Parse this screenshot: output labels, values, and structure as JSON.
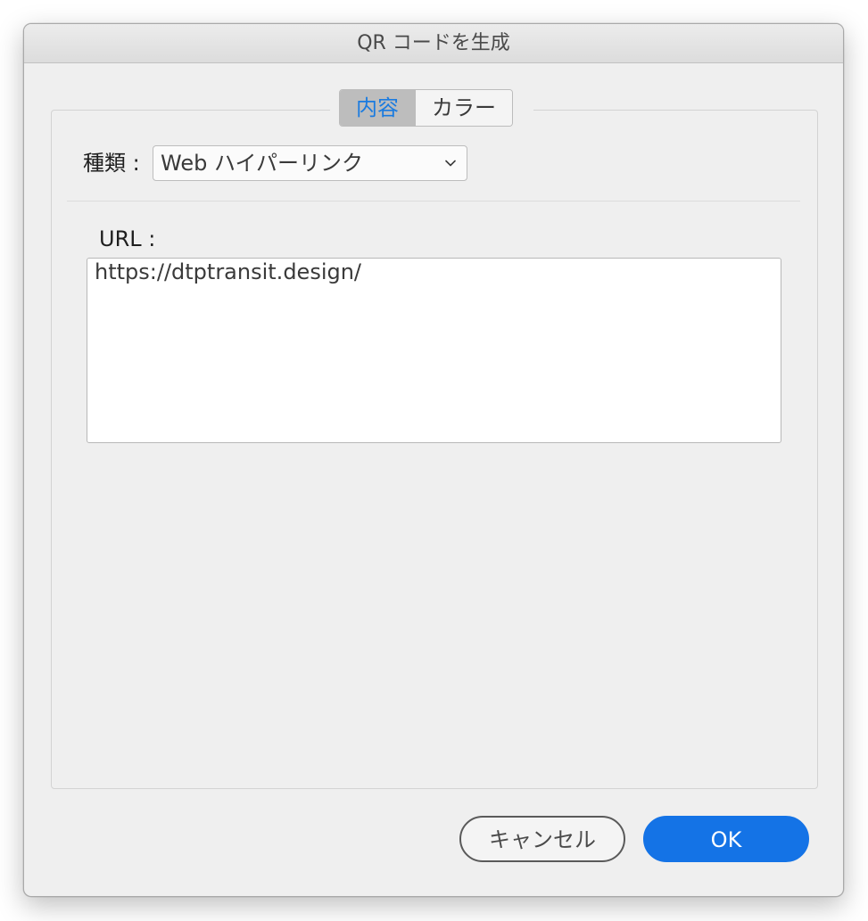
{
  "dialog": {
    "title": "QR コードを生成"
  },
  "tabs": [
    {
      "label": "内容",
      "selected": true
    },
    {
      "label": "カラー",
      "selected": false
    }
  ],
  "type": {
    "label": "種類 :",
    "selected_value": "Web ハイパーリンク",
    "icon": "chevron-down-icon"
  },
  "url": {
    "label": "URL :",
    "value": "https://dtptransit.design/"
  },
  "buttons": {
    "cancel_label": "キャンセル",
    "ok_label": "OK"
  },
  "colors": {
    "accent": "#1473e6",
    "active_tab_text": "#1a7be0",
    "dialog_background": "#efefef"
  }
}
